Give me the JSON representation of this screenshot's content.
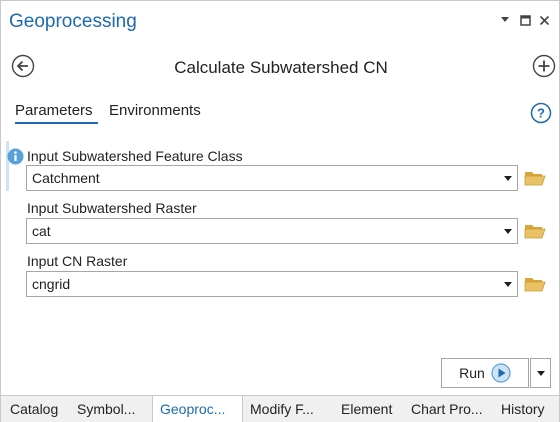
{
  "pane": {
    "title": "Geoprocessing",
    "window_controls": [
      "menu-arrow",
      "maximize",
      "close"
    ]
  },
  "header": {
    "tool_title": "Calculate Subwatershed CN",
    "back_icon": "back-arrow-circle",
    "add_icon": "plus-circle"
  },
  "tabs": {
    "parameters": "Parameters",
    "environments": "Environments",
    "help_icon": "question-circle"
  },
  "parameters": [
    {
      "label": "Input Subwatershed Feature Class",
      "value": "Catchment"
    },
    {
      "label": "Input Subwatershed Raster",
      "value": "cat"
    },
    {
      "label": "Input CN Raster",
      "value": "cngrid"
    }
  ],
  "run": {
    "label": "Run",
    "icon": "play-circle"
  },
  "bottom_tabs": [
    {
      "label": "Catalog",
      "active": false
    },
    {
      "label": "Symbol...",
      "active": false
    },
    {
      "label": "Geoproc...",
      "active": true
    },
    {
      "label": "Modify F...",
      "active": false
    },
    {
      "label": "Element",
      "active": false
    },
    {
      "label": "Chart Pro...",
      "active": false
    },
    {
      "label": "History",
      "active": false
    }
  ],
  "colors": {
    "accent": "#1d6ab1",
    "folder": "#e0b24a",
    "info": "#5aa0d8"
  }
}
